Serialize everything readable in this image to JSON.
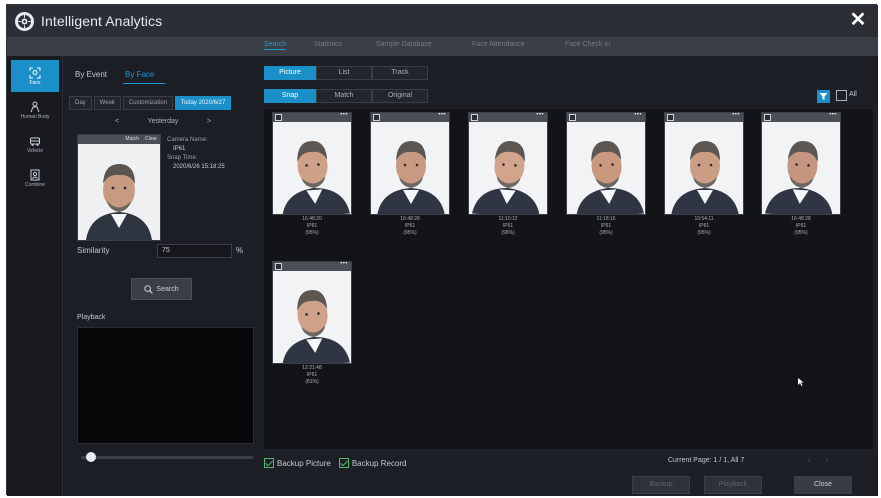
{
  "window": {
    "title": "Intelligent Analytics",
    "close_symbol": "✕"
  },
  "top_tabs": [
    {
      "label": "Search",
      "active": true
    },
    {
      "label": "Statistics",
      "active": false
    },
    {
      "label": "Sample Database",
      "active": false
    },
    {
      "label": "Face Attendance",
      "active": false
    },
    {
      "label": "Face Check In",
      "active": false
    }
  ],
  "rail": [
    {
      "label": "Face",
      "icon": "face-scan-icon",
      "active": true
    },
    {
      "label": "Human Body",
      "icon": "human-body-icon",
      "active": false
    },
    {
      "label": "Vehicle",
      "icon": "vehicle-icon",
      "active": false
    },
    {
      "label": "Combine",
      "icon": "combine-icon",
      "active": false
    }
  ],
  "left": {
    "sub_tabs": [
      {
        "label": "By Event",
        "active": false
      },
      {
        "label": "By Face",
        "active": true
      }
    ],
    "ranges": [
      {
        "label": "Day",
        "active": false
      },
      {
        "label": "Week",
        "active": false
      },
      {
        "label": "Customization",
        "active": false
      },
      {
        "label": "Today 2020/6/27",
        "active": true
      }
    ],
    "date_prev": "<",
    "date_label": "Yesterday",
    "date_next": ">",
    "card_tabs": [
      "Match",
      "Clear"
    ],
    "camera_name_label": "Camera Name:",
    "camera_name_value": "IP61",
    "snap_time_label": "Snap Time:",
    "snap_time_value": "2020/6/26 15:18:25",
    "similarity_label": "Similarity",
    "similarity_value": "75",
    "similarity_unit": "%",
    "search_label": "Search",
    "playback_label": "Playback",
    "playback_progress": 0.03
  },
  "right": {
    "view_modes": [
      {
        "label": "Picture",
        "active": true
      },
      {
        "label": "List",
        "active": false
      },
      {
        "label": "Track",
        "active": false
      }
    ],
    "image_modes": [
      {
        "label": "Snap",
        "active": true
      },
      {
        "label": "Match",
        "active": false
      },
      {
        "label": "Original",
        "active": false
      }
    ],
    "all_label": "All",
    "tiles": [
      {
        "time": "16:48:20",
        "camera": "IP61",
        "score": "(95%)"
      },
      {
        "time": "16:48:28",
        "camera": "IP61",
        "score": "(95%)"
      },
      {
        "time": "11:10:12",
        "camera": "IP61",
        "score": "(96%)"
      },
      {
        "time": "11:18:16",
        "camera": "IP61",
        "score": "(95%)"
      },
      {
        "time": "10:54:11",
        "camera": "IP61",
        "score": "(95%)"
      },
      {
        "time": "16:48:28",
        "camera": "IP61",
        "score": "(95%)"
      },
      {
        "time": "12:21:48",
        "camera": "IP61",
        "score": "(81%)"
      }
    ],
    "tile_more": "•••",
    "backup_picture_label": "Backup Picture",
    "backup_record_label": "Backup Record",
    "page_info": "Current Page: 1 / 1, All 7",
    "page_nav": "‹ ›",
    "buttons": {
      "backup": "Backup",
      "playback": "Playback",
      "close": "Close"
    }
  }
}
